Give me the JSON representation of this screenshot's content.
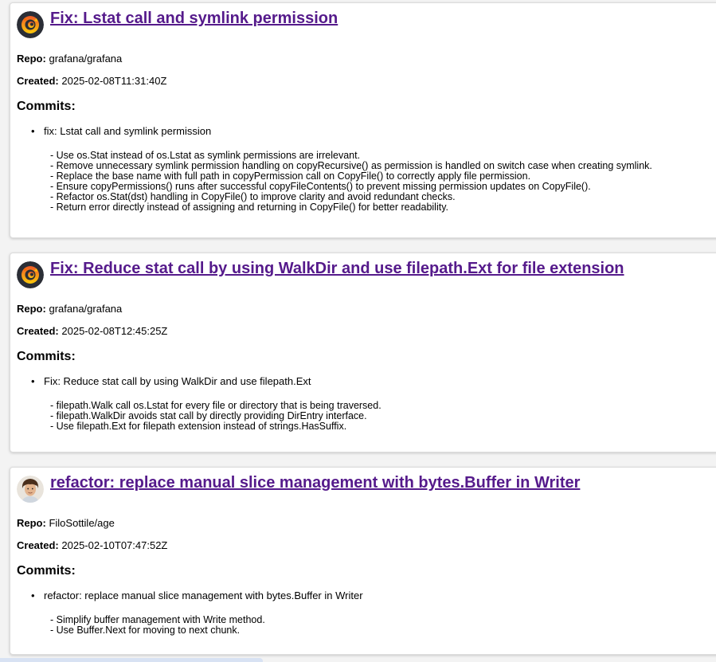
{
  "cards": [
    {
      "title": "Fix: Lstat call and symlink permission",
      "repo_label": "Repo:",
      "repo": "grafana/grafana",
      "created_label": "Created:",
      "created": "2025-02-08T11:31:40Z",
      "commits_heading": "Commits:",
      "avatar_icon": "grafana-logo-icon",
      "commit_message": "fix: Lstat call and symlink permission",
      "commit_body": "- Use os.Stat instead of os.Lstat as symlink permissions are irrelevant.\n- Remove unnecessary symlink permission handling on copyRecursive() as permission is handled on switch case when creating symlink.\n- Replace the base name with full path in copyPermission call on CopyFile() to correctly apply file permission.\n- Ensure copyPermissions() runs after successful copyFileContents() to prevent missing permission updates on CopyFile().\n- Refactor os.Stat(dst) handling in CopyFile() to improve clarity and avoid redundant checks.\n- Return error directly instead of assigning and returning in CopyFile() for better readability."
    },
    {
      "title": "Fix: Reduce stat call by using WalkDir and use filepath.Ext for file extension",
      "repo_label": "Repo:",
      "repo": "grafana/grafana",
      "created_label": "Created:",
      "created": "2025-02-08T12:45:25Z",
      "commits_heading": "Commits:",
      "avatar_icon": "grafana-logo-icon",
      "commit_message": "Fix: Reduce stat call by using WalkDir and use filepath.Ext",
      "commit_body": "- filepath.Walk call os.Lstat for every file or directory that is being traversed.\n- filepath.WalkDir avoids stat call by directly providing DirEntry interface.\n- Use filepath.Ext for filepath extension instead of strings.HasSuffix."
    },
    {
      "title": "refactor: replace manual slice management with bytes.Buffer in Writer",
      "repo_label": "Repo:",
      "repo": "FiloSottile/age",
      "created_label": "Created:",
      "created": "2025-02-10T07:47:52Z",
      "commits_heading": "Commits:",
      "avatar_icon": "user-avatar-icon",
      "commit_message": "refactor: replace manual slice management with bytes.Buffer in Writer",
      "commit_body": "- Simplify buffer management with Write method.\n- Use Buffer.Next for moving to next chunk."
    }
  ],
  "colors": {
    "link_visited": "#551a8b",
    "grafana_orange": "#f46800",
    "grafana_yellow": "#fbca0a"
  }
}
